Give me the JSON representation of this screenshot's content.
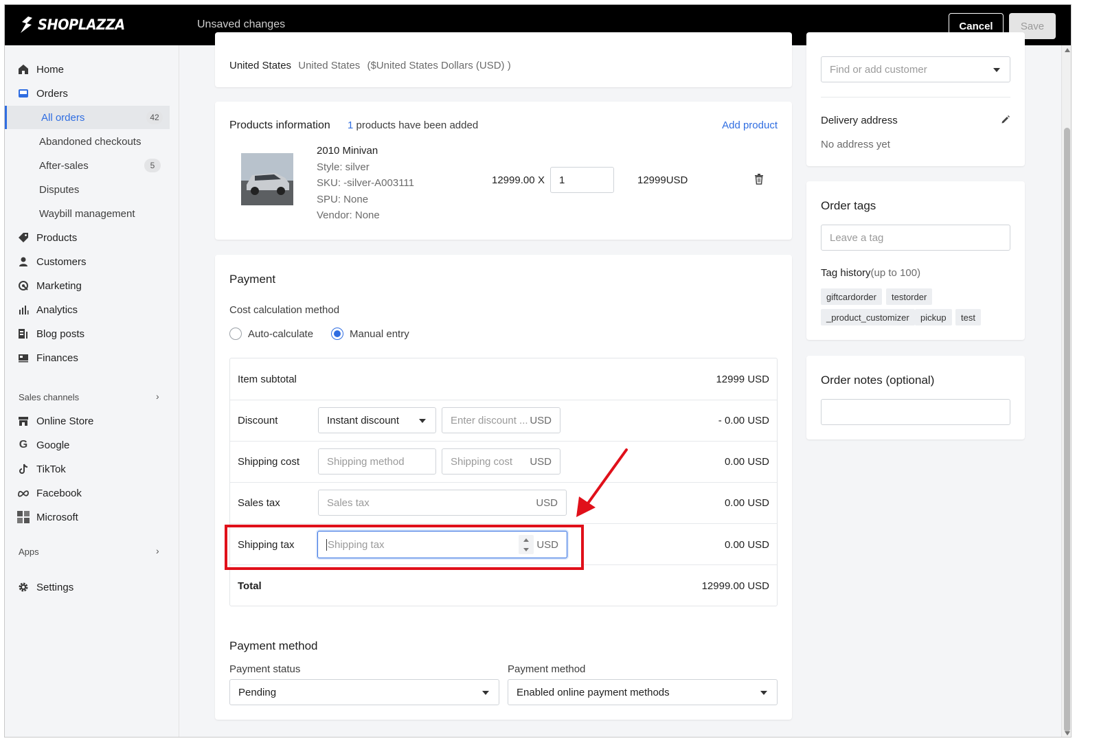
{
  "topbar": {
    "logo": "SHOPLAZZA",
    "status": "Unsaved changes",
    "cancel_label": "Cancel",
    "save_label": "Save"
  },
  "sidebar": {
    "items": [
      {
        "label": "Home",
        "icon": "home-icon"
      },
      {
        "label": "Orders",
        "icon": "orders-icon"
      },
      {
        "label": "All orders",
        "badge": "42"
      },
      {
        "label": "Abandoned checkouts"
      },
      {
        "label": "After-sales",
        "badge": "5"
      },
      {
        "label": "Disputes"
      },
      {
        "label": "Waybill management"
      },
      {
        "label": "Products",
        "icon": "tag-icon"
      },
      {
        "label": "Customers",
        "icon": "person-icon"
      },
      {
        "label": "Marketing",
        "icon": "marketing-icon"
      },
      {
        "label": "Analytics",
        "icon": "bar-chart-icon"
      },
      {
        "label": "Blog posts",
        "icon": "blog-icon"
      },
      {
        "label": "Finances",
        "icon": "finances-icon"
      }
    ],
    "sales_channels_label": "Sales channels",
    "channels": [
      {
        "label": "Online Store",
        "icon": "store-icon"
      },
      {
        "label": "Google",
        "icon": "google-icon"
      },
      {
        "label": "TikTok",
        "icon": "tiktok-icon"
      },
      {
        "label": "Facebook",
        "icon": "meta-icon"
      },
      {
        "label": "Microsoft",
        "icon": "microsoft-icon"
      }
    ],
    "apps_label": "Apps",
    "settings_label": "Settings"
  },
  "market": {
    "country": "United States",
    "detail": "United States",
    "currency": "($United States Dollars (USD) )"
  },
  "products": {
    "title": "Products information",
    "count": "1",
    "count_suffix": "products have been added",
    "add_label": "Add product",
    "item": {
      "name": "2010 Minivan",
      "style": "Style: silver",
      "sku": "SKU: -silver-A003111",
      "spu": "SPU: None",
      "vendor": "Vendor: None",
      "price": "12999.00",
      "times": "X",
      "quantity": "1",
      "line_total": "12999USD"
    }
  },
  "payment": {
    "title": "Payment",
    "method_label": "Cost calculation method",
    "option_auto": "Auto-calculate",
    "option_manual": "Manual entry",
    "selected": "manual",
    "rows": {
      "subtotal_label": "Item subtotal",
      "subtotal_value": "12999 USD",
      "discount_label": "Discount",
      "discount_type": "Instant discount",
      "discount_placeholder": "Enter discount ...",
      "discount_value": "- 0.00 USD",
      "shipping_label": "Shipping cost",
      "shipping_method_placeholder": "Shipping method",
      "shipping_cost_placeholder": "Shipping cost",
      "shipping_value": "0.00 USD",
      "sales_tax_label": "Sales tax",
      "sales_tax_placeholder": "Sales tax",
      "sales_tax_value": "0.00 USD",
      "shipping_tax_label": "Shipping tax",
      "shipping_tax_placeholder": "Shipping tax",
      "shipping_tax_value": "0.00 USD",
      "total_label": "Total",
      "total_value": "12999.00 USD",
      "currency": "USD"
    },
    "payment_method_title": "Payment method",
    "status_label": "Payment status",
    "status_value": "Pending",
    "method_select_label": "Payment method",
    "method_value": "Enabled online payment methods"
  },
  "right": {
    "customer_placeholder": "Find or add customer",
    "delivery_title": "Delivery address",
    "delivery_value": "No address yet",
    "tags_title": "Order tags",
    "tag_placeholder": "Leave a tag",
    "tag_history_label": "Tag history",
    "tag_history_limit": "(up to 100)",
    "tags": [
      "giftcardorder",
      "testorder",
      "_product_customizer",
      "pickup",
      "test"
    ],
    "notes_title": "Order notes (optional)"
  },
  "colors": {
    "accent": "#2f6de1",
    "highlight": "#e0101a",
    "topbar": "#000000"
  }
}
